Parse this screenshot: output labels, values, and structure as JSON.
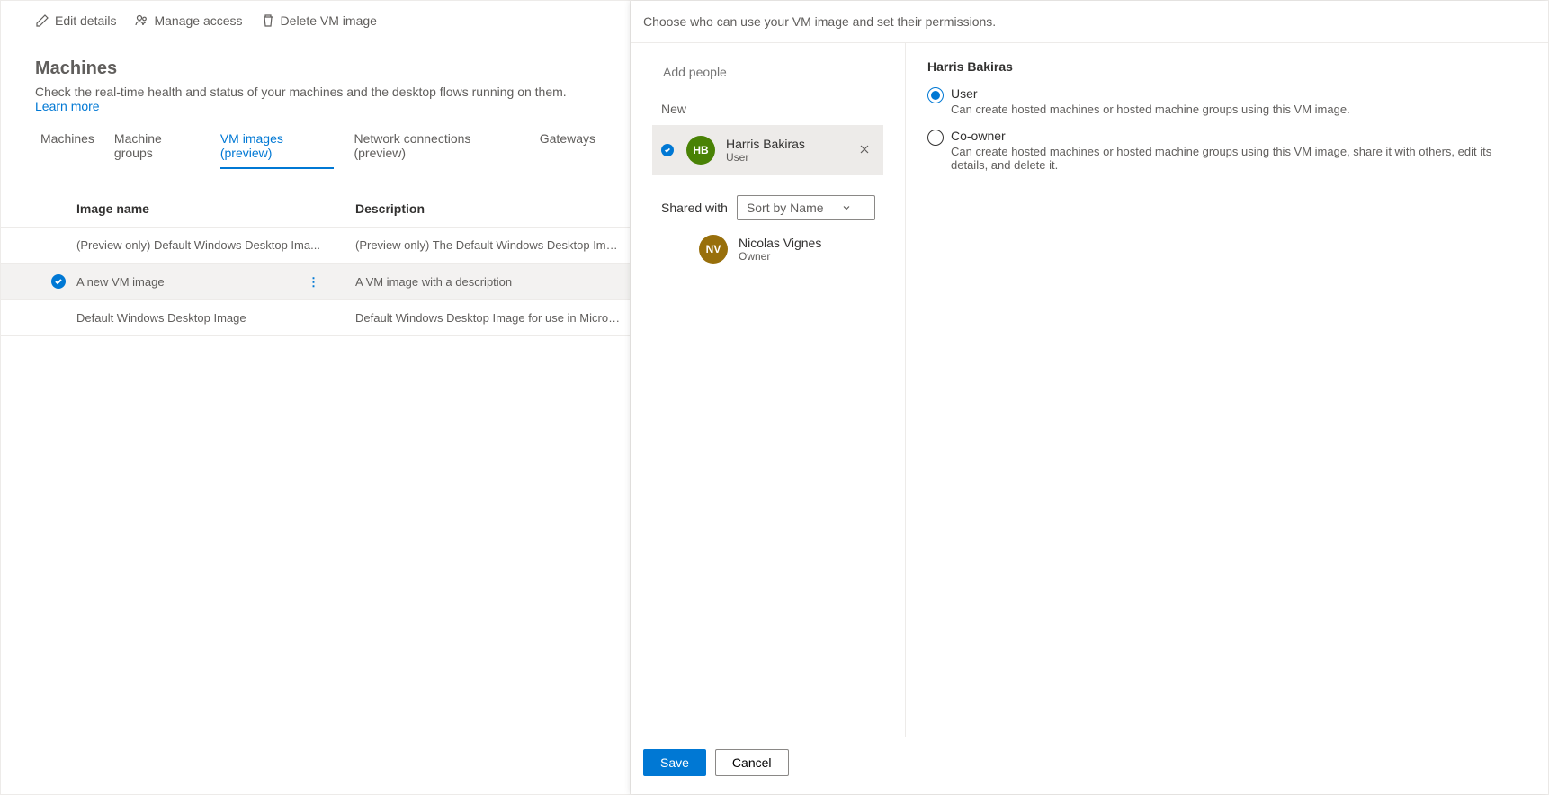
{
  "toolbar": {
    "edit": "Edit details",
    "manage": "Manage access",
    "delete": "Delete VM image"
  },
  "page": {
    "title": "Machines",
    "subtitle_prefix": "Check the real-time health and status of your machines and the desktop flows running on them. ",
    "learn_more": "Learn more"
  },
  "tabs": {
    "machines": "Machines",
    "groups": "Machine groups",
    "vmimages": "VM images (preview)",
    "network": "Network connections (preview)",
    "gateways": "Gateways"
  },
  "grid": {
    "col_name": "Image name",
    "col_desc": "Description",
    "rows": [
      {
        "name": "(Preview only) Default Windows Desktop Ima...",
        "desc": "(Preview only) The Default Windows Desktop Image for use i..."
      },
      {
        "name": "A new VM image",
        "desc": "A VM image with a description"
      },
      {
        "name": "Default Windows Desktop Image",
        "desc": "Default Windows Desktop Image for use in Microsoft Deskto..."
      }
    ]
  },
  "panel": {
    "header": "Choose who can use your VM image and set their permissions.",
    "add_people_placeholder": "Add people",
    "new_label": "New",
    "new_person": {
      "initials": "HB",
      "name": "Harris Bakiras",
      "role": "User"
    },
    "shared_label": "Shared with",
    "sort_label": "Sort by Name",
    "owner": {
      "initials": "NV",
      "name": "Nicolas Vignes",
      "role": "Owner"
    },
    "perm_heading": "Harris Bakiras",
    "perm_user": {
      "label": "User",
      "desc": "Can create hosted machines or hosted machine groups using this VM image."
    },
    "perm_coowner": {
      "label": "Co-owner",
      "desc": "Can create hosted machines or hosted machine groups using this VM image, share it with others, edit its details, and delete it."
    },
    "save": "Save",
    "cancel": "Cancel"
  }
}
